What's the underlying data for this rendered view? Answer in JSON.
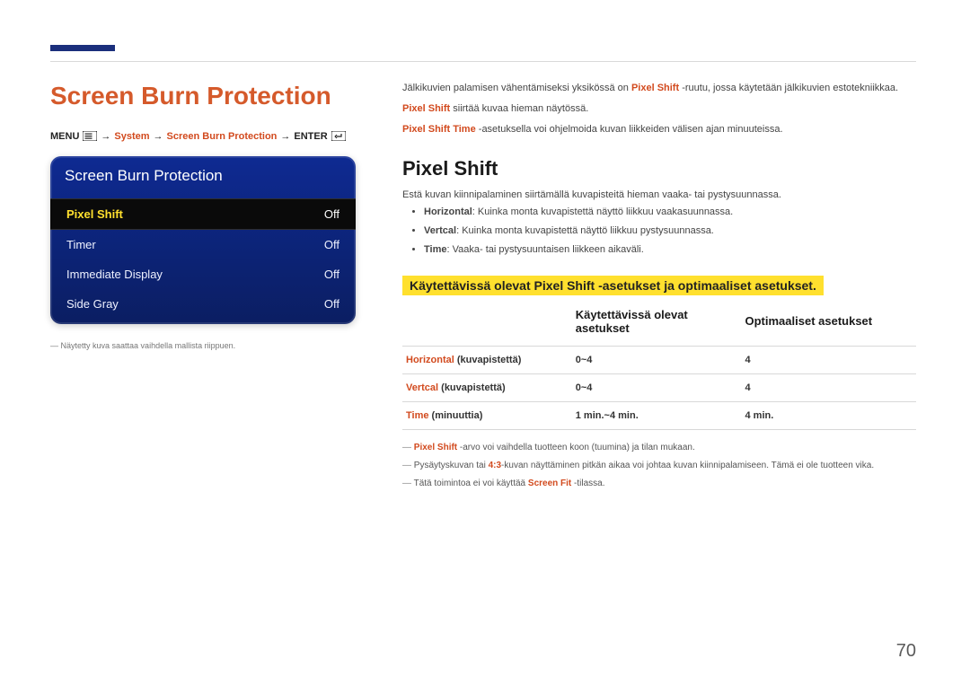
{
  "page_number": "70",
  "title": "Screen Burn Protection",
  "breadcrumb": {
    "menu": "MENU",
    "p1": "System",
    "p2": "Screen Burn Protection",
    "enter": "ENTER"
  },
  "panel": {
    "header": "Screen Burn Protection",
    "rows": [
      {
        "name": "Pixel Shift",
        "value": "Off",
        "selected": true
      },
      {
        "name": "Timer",
        "value": "Off",
        "selected": false
      },
      {
        "name": "Immediate Display",
        "value": "Off",
        "selected": false
      },
      {
        "name": "Side Gray",
        "value": "Off",
        "selected": false
      }
    ]
  },
  "left_footnote": "Näytetty kuva saattaa vaihdella mallista riippuen.",
  "intro": {
    "p1_pre": "Jälkikuvien palamisen vähentämiseksi yksikössä on ",
    "p1_key": "Pixel Shift",
    "p1_post": " -ruutu, jossa käytetään jälkikuvien estotekniikkaa.",
    "p2_key": "Pixel Shift",
    "p2_post": " siirtää kuvaa hieman näytössä.",
    "p3_key": "Pixel Shift Time",
    "p3_post": " -asetuksella voi ohjelmoida kuvan liikkeiden välisen ajan minuuteissa."
  },
  "subheading": "Pixel Shift",
  "subdesc": "Estä kuvan kiinnipalaminen siirtämällä kuvapisteitä hieman vaaka- tai pystysuunnassa.",
  "bullets": [
    {
      "k": "Horizontal",
      "t": ": Kuinka monta kuvapistettä näyttö liikkuu vaakasuunnassa."
    },
    {
      "k": "Vertcal",
      "t": ": Kuinka monta kuvapistettä näyttö liikkuu pystysuunnassa."
    },
    {
      "k": "Time",
      "t": ": Vaaka- tai pystysuuntaisen liikkeen aikaväli."
    }
  ],
  "yellow": "Käytettävissä olevat Pixel Shift -asetukset ja optimaaliset asetukset.",
  "table": {
    "head": [
      "",
      "Käytettävissä olevat asetukset",
      "Optimaaliset asetukset"
    ],
    "rows": [
      {
        "key": "Horizontal",
        "unit": " (kuvapistettä)",
        "available": "0~4",
        "optimal": "4"
      },
      {
        "key": "Vertcal",
        "unit": " (kuvapistettä)",
        "available": "0~4",
        "optimal": "4"
      },
      {
        "key": "Time",
        "unit": " (minuuttia)",
        "available": "1 min.~4 min.",
        "optimal": "4 min."
      }
    ]
  },
  "notes": [
    {
      "pre": "",
      "hl": "Pixel Shift",
      "post": " -arvo voi vaihdella tuotteen koon (tuumina) ja tilan mukaan."
    },
    {
      "pre": "Pysäytyskuvan tai ",
      "hl": "4:3",
      "post": "-kuvan näyttäminen pitkän aikaa voi johtaa kuvan kiinnipalamiseen. Tämä ei ole tuotteen vika."
    },
    {
      "pre": "Tätä toimintoa ei voi käyttää ",
      "hl": "Screen Fit",
      "post": " -tilassa."
    }
  ]
}
